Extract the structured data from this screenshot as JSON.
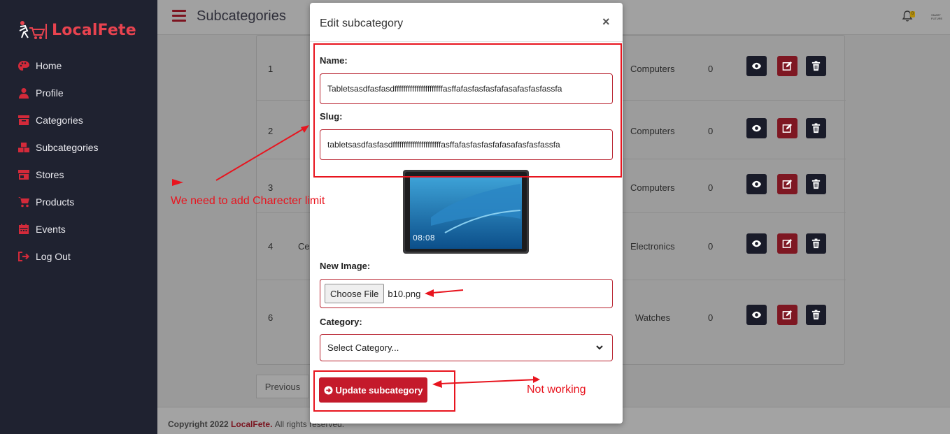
{
  "brand": {
    "name": "LocalFete"
  },
  "sidebar": {
    "items": [
      {
        "label": "Home",
        "icon": "palette-icon"
      },
      {
        "label": "Profile",
        "icon": "user-icon"
      },
      {
        "label": "Categories",
        "icon": "archive-icon"
      },
      {
        "label": "Subcategories",
        "icon": "boxes-icon"
      },
      {
        "label": "Stores",
        "icon": "store-icon"
      },
      {
        "label": "Products",
        "icon": "cart-icon"
      },
      {
        "label": "Events",
        "icon": "calendar-icon"
      },
      {
        "label": "Log Out",
        "icon": "logout-icon"
      }
    ]
  },
  "header": {
    "title": "Subcategories",
    "notification_count": "0",
    "user_text": "SMART FUTURE"
  },
  "table": {
    "rows": [
      {
        "num": "1",
        "name": "",
        "category": "Computers",
        "count": "0"
      },
      {
        "num": "2",
        "name": "",
        "category": "Computers",
        "count": "0"
      },
      {
        "num": "3",
        "name": "",
        "category": "Computers",
        "count": "0"
      },
      {
        "num": "4",
        "name": "Ce",
        "category": "Electronics",
        "count": "0"
      },
      {
        "num": "6",
        "name": "",
        "category": "Watches",
        "count": "0"
      }
    ]
  },
  "pagination": {
    "previous": "Previous"
  },
  "footer": {
    "copyright": "Copyright 2022",
    "brand": "LocalFete.",
    "rights": "All rights reserved."
  },
  "modal": {
    "title": "Edit subcategory",
    "close": "×",
    "name_label": "Name:",
    "name_value": "Tabletsasdfasfasdffffffffffffffffffffffasffafasfasfasfafasafasfasfassfa",
    "slug_label": "Slug:",
    "slug_value": "tabletsasdfasfasdffffffffffffffffffffffasffafasfasfasfafasafasfasfassfa",
    "new_image_label": "New Image:",
    "file_button": "Choose File",
    "file_name": "b10.png",
    "category_label": "Category:",
    "category_placeholder": "Select Category...",
    "submit": "Update subcategory"
  },
  "annotations": {
    "char_limit": "We need to add Charecter limit",
    "not_working": "Not working"
  },
  "colors": {
    "accent": "#c41a2b",
    "sidebar": "#1f2230",
    "annotation": "#e8141e"
  }
}
